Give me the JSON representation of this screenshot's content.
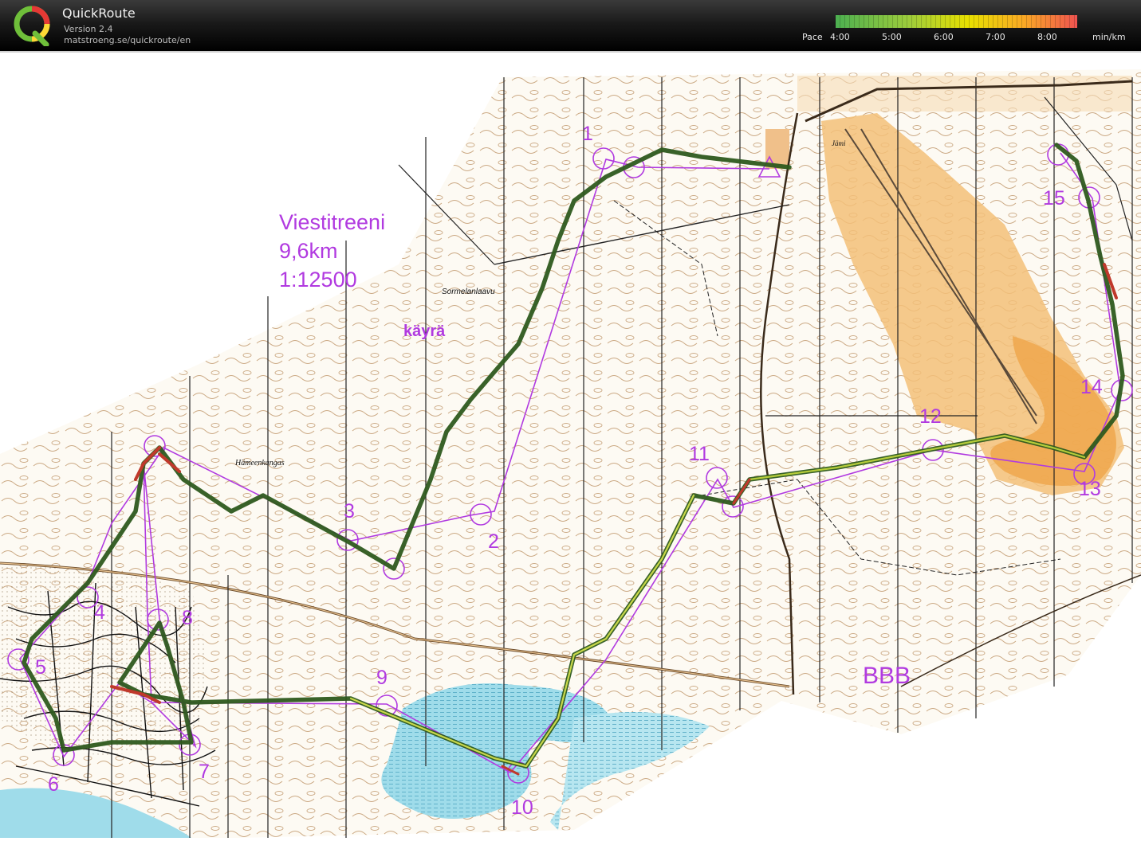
{
  "header": {
    "app_name": "QuickRoute",
    "version": "Version 2.4",
    "url": "matstroeng.se/quickroute/en",
    "pace_label": "Pace",
    "pace_ticks": [
      "4:00",
      "5:00",
      "6:00",
      "7:00",
      "8:00"
    ],
    "pace_unit": "min/km",
    "pace_colors": [
      "#4caf50",
      "#9ccc3c",
      "#e8e000",
      "#f9a825",
      "#ef5350"
    ]
  },
  "map": {
    "title_lines": [
      "Viestitreeni",
      "9,6km",
      "1:12500"
    ],
    "note": "käyrä",
    "corner_label": "BBB",
    "place_names": [
      "Sormelanlaavu",
      "Hämeenkangas",
      "Jämi"
    ],
    "control_numbers": [
      "1",
      "2",
      "3",
      "4",
      "5",
      "6",
      "7",
      "8",
      "9",
      "10",
      "11",
      "12",
      "13",
      "14",
      "15"
    ],
    "colors": {
      "course": "#b13ae0",
      "route": "#3b6e23",
      "route_slow": "#c0392b",
      "contour": "#a0703a",
      "open_land": "#f3b063",
      "water": "#8fd3e6"
    }
  }
}
